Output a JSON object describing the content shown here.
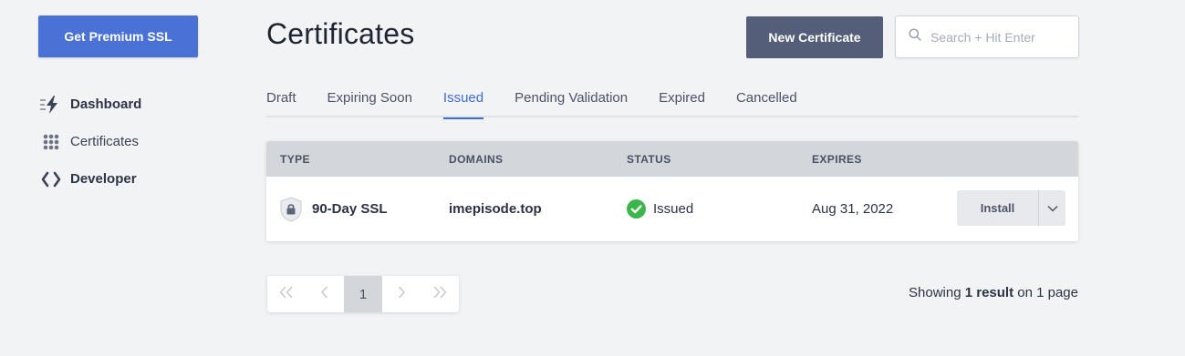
{
  "sidebar": {
    "premium_button": "Get Premium SSL",
    "items": [
      {
        "label": "Dashboard",
        "icon": "lightning-icon"
      },
      {
        "label": "Certificates",
        "icon": "grid-dots-icon"
      },
      {
        "label": "Developer",
        "icon": "code-brackets-icon"
      }
    ]
  },
  "header": {
    "title": "Certificates",
    "new_button": "New Certificate",
    "search_placeholder": "Search + Hit Enter"
  },
  "tabs": [
    {
      "label": "Draft",
      "active": false
    },
    {
      "label": "Expiring Soon",
      "active": false
    },
    {
      "label": "Issued",
      "active": true
    },
    {
      "label": "Pending Validation",
      "active": false
    },
    {
      "label": "Expired",
      "active": false
    },
    {
      "label": "Cancelled",
      "active": false
    }
  ],
  "table": {
    "columns": [
      "TYPE",
      "DOMAINS",
      "STATUS",
      "EXPIRES"
    ],
    "rows": [
      {
        "type": "90-Day SSL",
        "domain": "imepisode.top",
        "status": "Issued",
        "expires": "Aug 31, 2022",
        "action": "Install"
      }
    ]
  },
  "pagination": {
    "current_page": "1",
    "showing_prefix": "Showing ",
    "showing_count": "1 result",
    "showing_suffix": " on 1 page"
  },
  "colors": {
    "accent": "#3f6ad8",
    "premium_button": "#4a72d6",
    "new_button": "#545e78",
    "status_ok": "#3cb54a"
  }
}
